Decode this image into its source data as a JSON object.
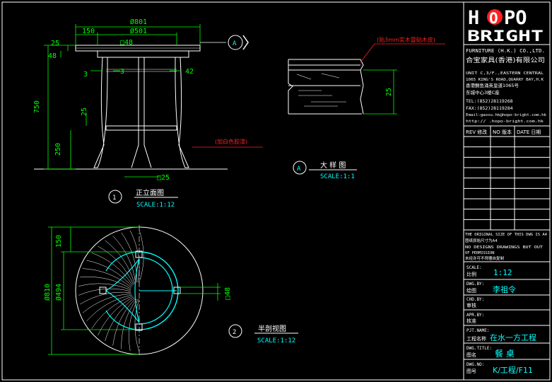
{
  "colors": {
    "background": "#000000",
    "frame": "#ffffff",
    "dimension": "#00ff00",
    "object": "#ffffff",
    "label": "#00ffff",
    "annotation": "#ff2020",
    "title_value": "#00ffff"
  },
  "logo": {
    "line1_left": "H",
    "line1_o": "O",
    "line1_right": "PO",
    "line2": "BRIGHT"
  },
  "company": {
    "name_en": "FURNITURE (H.K.) CO.,LTD.",
    "name_cn": "合宝家具(香港)有限公司",
    "address_lines": [
      "UNIT C,3/F.,EASTERN CENTRAL",
      "1065 KING'S ROAD,QUARRY BAY,H.K",
      "香港鲗鱼涌英皇道1065号",
      "东城中心3楼C座",
      "TEL:(852)28119268",
      "FAX:(852)28119284",
      "Email:gaoxu.hk@hopo-bright.com.hk",
      "http:// .hopo-bright.com.hk"
    ]
  },
  "revision_table": {
    "headers": [
      "REV 修改",
      "NO 版本",
      "DATE 日期"
    ],
    "empty_rows": 9
  },
  "notes": [
    "THE ORIGINAL SIZE OF THIS DWG IS A4",
    "图纸原始尺寸为A4",
    "NO DESIGNS DRAWINGS BUT OUT",
    "OF PERMISSION",
    "未经许可不得擅自复制"
  ],
  "title_block": {
    "scale": {
      "label_en": "SCALE:",
      "label_cn": "比例",
      "value": "1:12"
    },
    "drawn_by": {
      "label_en": "DWG.BY:",
      "label_cn": "绘图",
      "value": "李祖令"
    },
    "checked_by": {
      "label_en": "CHD.BY:",
      "label_cn": "审核",
      "value": ""
    },
    "approved_by": {
      "label_en": "APR.BY:",
      "label_cn": "核准",
      "value": ""
    },
    "project": {
      "label_en": "PJT.NAME:",
      "label_cn": "工程名称",
      "value": "在水一方工程"
    },
    "title": {
      "label_en": "DWG.TITLE:",
      "label_cn": "图名",
      "value": "餐 桌"
    },
    "number": {
      "label_en": "DWG.NO:",
      "label_cn": "图号",
      "value": "K/工程/F11"
    }
  },
  "views": {
    "front": {
      "number": "1",
      "title": "正立面图",
      "scale": "SCALE:1:12"
    },
    "detail": {
      "number": "A",
      "title": "大 样 图",
      "scale": "SCALE:1:1"
    },
    "plan": {
      "number": "2",
      "title": "半剖视图",
      "scale": "SCALE:1:12"
    }
  },
  "section_marker": "A",
  "dimensions": {
    "front": {
      "overall_top": "Ø801",
      "inner_top": "Ø501",
      "offset_left": "150",
      "rail": "□48",
      "top_thickness": "25",
      "apron_height": "48",
      "leg_left": "3",
      "leg_mid": "3",
      "leg_right": "42",
      "total_height": "750",
      "stretcher": "25",
      "foot_height": "250",
      "base": "□25"
    },
    "detail": {
      "thickness": "25"
    },
    "plan": {
      "outer": "Ø810",
      "inner": "Ø494",
      "offset": "150",
      "rail": "□48"
    }
  },
  "annotations": {
    "veneer": "(贴3mm实木冒贴木皮)",
    "paint": "(加白色胶漆)"
  }
}
